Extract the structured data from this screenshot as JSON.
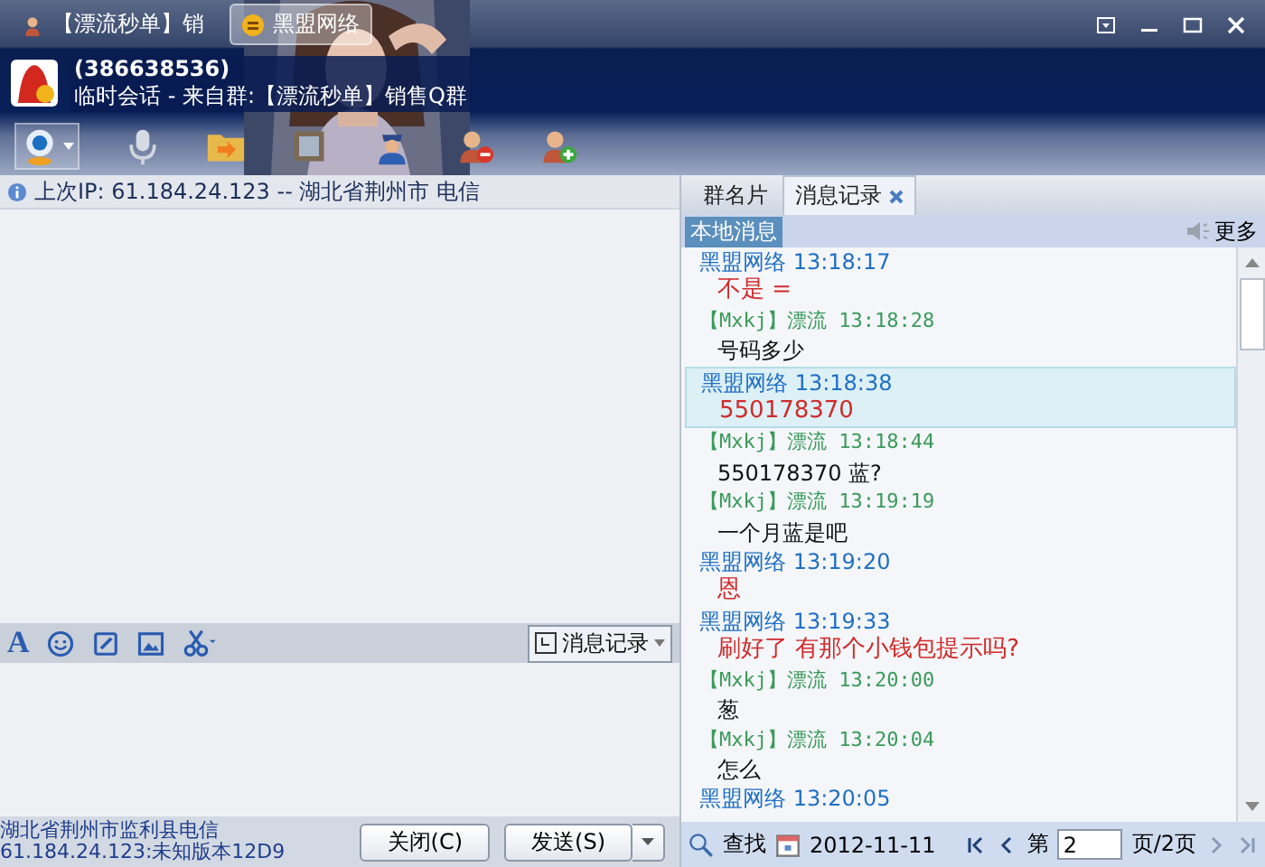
{
  "title_tabs": [
    {
      "label": "【漂流秒单】销",
      "selected": false
    },
    {
      "label": "黑盟网络",
      "selected": true
    }
  ],
  "header": {
    "qq_number": "(386638536)",
    "session": "临时会话 - 来自群:【漂流秒单】销售Q群"
  },
  "info_bar": {
    "text": "上次IP: 61.184.24.123 -- 湖北省荆州市 电信"
  },
  "input_toolbar": {
    "font_button": "A",
    "history_button": "消息记录"
  },
  "status": {
    "location": "湖北省荆州市监利县电信",
    "version": "61.184.24.123:未知版本12D9"
  },
  "buttons": {
    "close": "关闭(C)",
    "send": "发送(S)"
  },
  "side_tabs": [
    {
      "label": "群名片",
      "selected": false
    },
    {
      "label": "消息记录",
      "selected": true
    }
  ],
  "local_label": "本地消息",
  "more": "更多",
  "messages": [
    {
      "kind": "self",
      "sender": "黑盟网络",
      "time": "13:18:17",
      "selected": false
    },
    {
      "kind": "self",
      "text": "不是 =",
      "selected": false
    },
    {
      "kind": "other",
      "sender": "【Mxkj】漂流",
      "time": "13:18:28",
      "text": "号码多少",
      "selected": false
    },
    {
      "kind": "self",
      "sender": "黑盟网络",
      "time": "13:18:38",
      "text": "550178370",
      "selected": true
    },
    {
      "kind": "other",
      "sender": "【Mxkj】漂流",
      "time": "13:18:44",
      "text": "550178370 蓝?",
      "selected": false
    },
    {
      "kind": "other",
      "sender": "【Mxkj】漂流",
      "time": "13:19:19",
      "text": "一个月蓝是吧",
      "selected": false
    },
    {
      "kind": "self",
      "sender": "黑盟网络",
      "time": "13:19:20",
      "text": "恩",
      "selected": false
    },
    {
      "kind": "self",
      "sender": "黑盟网络",
      "time": "13:19:33",
      "text": "刷好了 有那个小钱包提示吗?",
      "selected": false
    },
    {
      "kind": "other",
      "sender": "【Mxkj】漂流",
      "time": "13:20:00",
      "text": "葱",
      "selected": false
    },
    {
      "kind": "other",
      "sender": "【Mxkj】漂流",
      "time": "13:20:04",
      "text": "怎么",
      "selected": false
    },
    {
      "kind": "self",
      "sender": "黑盟网络",
      "time": "13:20:05",
      "selected": false
    }
  ],
  "history_footer": {
    "search": "查找",
    "date": "2012-11-11",
    "page_prefix": "第",
    "page": "2",
    "page_suffix": "页/2页"
  }
}
